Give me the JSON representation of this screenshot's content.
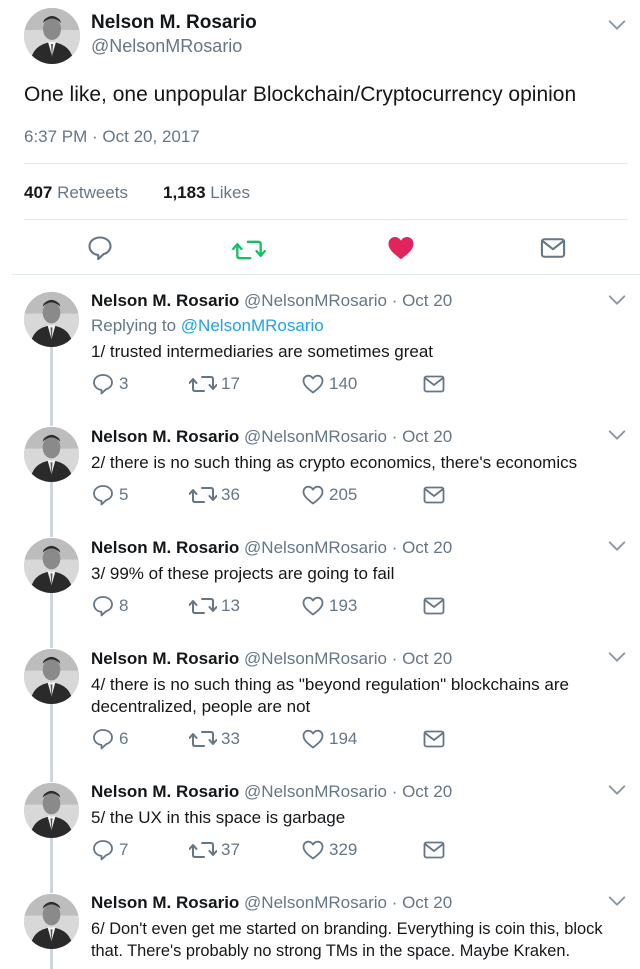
{
  "main_tweet": {
    "name": "Nelson M. Rosario",
    "handle": "@NelsonMRosario",
    "text": "One like, one unpopular Blockchain/Cryptocurrency opinion",
    "timestamp": "6:37 PM · Oct 20, 2017",
    "retweets_count": "407",
    "retweets_label": "Retweets",
    "likes_count": "1,183",
    "likes_label": "Likes"
  },
  "colors": {
    "accent": "#1da1f2",
    "like": "#e0245e",
    "retweet": "#17bf63",
    "gray": "#657786"
  },
  "icons": [
    "reply-icon",
    "retweet-icon",
    "heart-icon",
    "dm-icon",
    "chevron-down-icon"
  ],
  "replies": [
    {
      "name": "Nelson M. Rosario",
      "handle": "@NelsonMRosario",
      "date": "· Oct 20",
      "replying_prefix": "Replying to",
      "replying_to": "@NelsonMRosario",
      "line1": "1/ trusted intermediaries are sometimes great",
      "line2": "",
      "replies": "3",
      "retweets": "17",
      "likes": "140"
    },
    {
      "name": "Nelson M. Rosario",
      "handle": "@NelsonMRosario",
      "date": "· Oct 20",
      "line1": "2/ there is no such thing as crypto economics, there's economics",
      "line2": "",
      "replies": "5",
      "retweets": "36",
      "likes": "205"
    },
    {
      "name": "Nelson M. Rosario",
      "handle": "@NelsonMRosario",
      "date": "· Oct 20",
      "line1": "3/ 99% of these projects are going to fail",
      "line2": "",
      "replies": "8",
      "retweets": "13",
      "likes": "193"
    },
    {
      "name": "Nelson M. Rosario",
      "handle": "@NelsonMRosario",
      "date": "· Oct 20",
      "line1": "4/ there is no such thing as \"beyond regulation\" blockchains are",
      "line2": "decentralized, people are not",
      "replies": "6",
      "retweets": "33",
      "likes": "194"
    },
    {
      "name": "Nelson M. Rosario",
      "handle": "@NelsonMRosario",
      "date": "· Oct 20",
      "line1": "5/ the UX in this space is garbage",
      "line2": "",
      "replies": "7",
      "retweets": "37",
      "likes": "329"
    },
    {
      "name": "Nelson M. Rosario",
      "handle": "@NelsonMRosario",
      "date": "· Oct 20",
      "line1": "6/ Don't even get me started on branding. Everything is coin this, block",
      "line2": "that. There's probably no strong TMs in the space. Maybe Kraken."
    }
  ]
}
